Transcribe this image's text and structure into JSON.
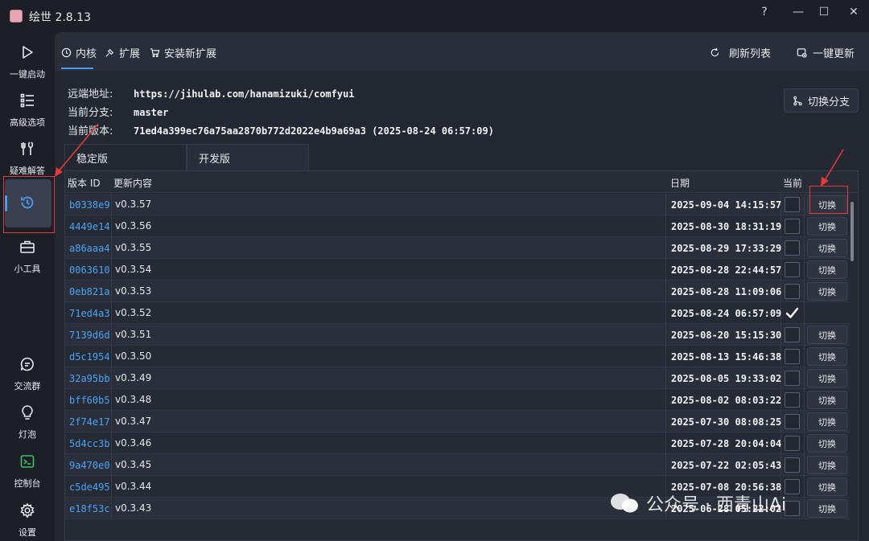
{
  "window": {
    "title": "绘世 2.8.13",
    "help": "?",
    "minimize": "—",
    "maximize": "☐",
    "close": "✕"
  },
  "sidebar": {
    "items": [
      {
        "label": "一键启动",
        "icon": "play-icon"
      },
      {
        "label": "高级选项",
        "icon": "list-icon"
      },
      {
        "label": "疑难解答",
        "icon": "tools-icon"
      },
      {
        "label": "",
        "icon": "history-icon"
      },
      {
        "label": "小工具",
        "icon": "toolbox-icon"
      },
      {
        "label": "交流群",
        "icon": "chat-icon"
      },
      {
        "label": "灯泡",
        "icon": "bulb-icon"
      },
      {
        "label": "控制台",
        "icon": "console-icon"
      },
      {
        "label": "设置",
        "icon": "gear-icon"
      }
    ]
  },
  "topnav": {
    "tabs": [
      {
        "label": "内核",
        "icon": "history-icon"
      },
      {
        "label": "扩展",
        "icon": "extension-icon"
      },
      {
        "label": "安装新扩展",
        "icon": "cart-icon"
      }
    ],
    "refresh_label": "刷新列表",
    "update_label": "一键更新"
  },
  "info": {
    "remote_label": "远端地址:",
    "remote_value": "https://jihulab.com/hanamizuki/comfyui",
    "branch_label": "当前分支:",
    "branch_value": "master",
    "version_label": "当前版本:",
    "version_value": "71ed4a399ec76a75aa2870b772d2022e4b9a69a3 (2025-08-24 06:57:09)"
  },
  "switch_branch_label": "切换分支",
  "branch_tabs": [
    "稳定版",
    "开发版"
  ],
  "table": {
    "headers": {
      "id": "版本 ID",
      "content": "更新内容",
      "date": "日期",
      "current": "当前"
    },
    "switch_label": "切换",
    "rows": [
      {
        "id": "b0338e9",
        "version": "v0.3.57",
        "date": "2025-09-04 14:15:57",
        "current": false
      },
      {
        "id": "4449e14",
        "version": "v0.3.56",
        "date": "2025-08-30 18:31:19",
        "current": false
      },
      {
        "id": "a86aaa4",
        "version": "v0.3.55",
        "date": "2025-08-29 17:33:29",
        "current": false
      },
      {
        "id": "0063610",
        "version": "v0.3.54",
        "date": "2025-08-28 22:44:57",
        "current": false
      },
      {
        "id": "0eb821a",
        "version": "v0.3.53",
        "date": "2025-08-28 11:09:06",
        "current": false
      },
      {
        "id": "71ed4a3",
        "version": "v0.3.52",
        "date": "2025-08-24 06:57:09",
        "current": true
      },
      {
        "id": "7139d6d",
        "version": "v0.3.51",
        "date": "2025-08-20 15:15:30",
        "current": false
      },
      {
        "id": "d5c1954",
        "version": "v0.3.50",
        "date": "2025-08-13 15:46:38",
        "current": false
      },
      {
        "id": "32a95bb",
        "version": "v0.3.49",
        "date": "2025-08-05 19:33:02",
        "current": false
      },
      {
        "id": "bff60b5",
        "version": "v0.3.48",
        "date": "2025-08-02 08:03:22",
        "current": false
      },
      {
        "id": "2f74e17",
        "version": "v0.3.47",
        "date": "2025-07-30 08:08:25",
        "current": false
      },
      {
        "id": "5d4cc3b",
        "version": "v0.3.46",
        "date": "2025-07-28 20:04:04",
        "current": false
      },
      {
        "id": "9a470e0",
        "version": "v0.3.45",
        "date": "2025-07-22 02:05:43",
        "current": false
      },
      {
        "id": "c5de495",
        "version": "v0.3.44",
        "date": "2025-07-08 20:56:38",
        "current": false
      },
      {
        "id": "e18f53c",
        "version": "v0.3.43",
        "date": "2025-06-28 05:22:02",
        "current": false
      }
    ]
  },
  "watermark": "公众号 · 西青山Ai",
  "colors": {
    "accent": "#4a9cf0",
    "annotation": "#e03a3a"
  }
}
